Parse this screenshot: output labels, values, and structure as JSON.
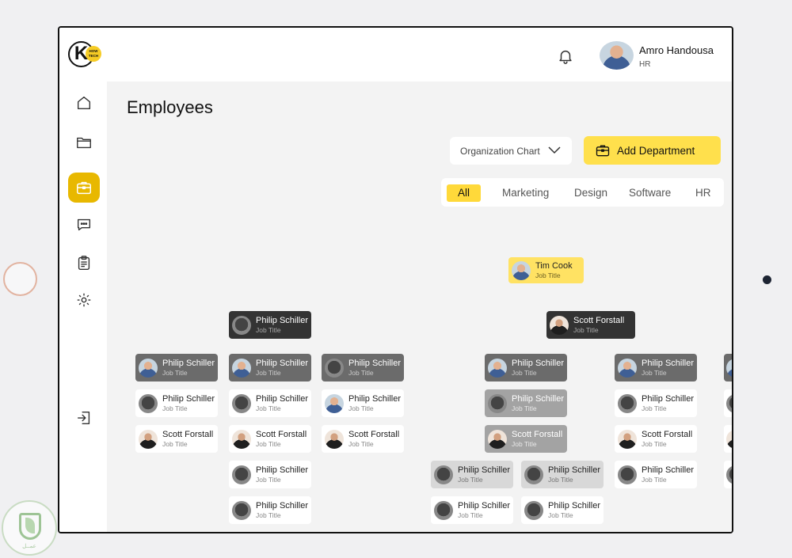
{
  "header": {
    "logo_letter": "K",
    "logo_tag": "HOW TECH",
    "user_name": "Amro Handousa",
    "user_role": "HR"
  },
  "sidebar": {
    "items": [
      {
        "icon": "home-icon"
      },
      {
        "icon": "folder-icon"
      },
      {
        "icon": "briefcase-icon",
        "active": true
      },
      {
        "icon": "chat-icon"
      },
      {
        "icon": "clipboard-icon"
      },
      {
        "icon": "gear-icon"
      }
    ],
    "logout_icon": "logout-icon"
  },
  "main": {
    "title": "Employees",
    "view_select": "Organization Chart",
    "add_button": "Add Department",
    "filters": [
      "All",
      "Marketing",
      "Design",
      "Software",
      "HR"
    ],
    "active_filter": "All"
  },
  "org": {
    "root": {
      "name": "Tim Cook",
      "job": "Job Title"
    },
    "leads": [
      {
        "name": "Philip Schiller",
        "job": "Job Title"
      },
      {
        "name": "Scott Forstall",
        "job": "Job Title"
      }
    ],
    "cards": [
      {
        "name": "Philip Schiller",
        "job": "Job Title"
      },
      {
        "name": "Philip Schiller",
        "job": "Job Title"
      },
      {
        "name": "Philip Schiller",
        "job": "Job Title"
      },
      {
        "name": "Philip Schiller",
        "job": "Job Title"
      },
      {
        "name": "Philip Schiller",
        "job": "Job Title"
      },
      {
        "name": "Philip Schiller",
        "job": "Job Title"
      },
      {
        "name": "Philip Schiller",
        "job": "Job Title"
      },
      {
        "name": "Philip Schiller",
        "job": "Job Title"
      },
      {
        "name": "Scott Forstall",
        "job": "Job Title"
      },
      {
        "name": "Scott Forstall",
        "job": "Job Title"
      },
      {
        "name": "Scott Forstall",
        "job": "Job Title"
      },
      {
        "name": "Philip Schiller",
        "job": "Job Title"
      },
      {
        "name": "Philip Schiller",
        "job": "Job Title"
      },
      {
        "name": "Philip Schiller",
        "job": "Job Title"
      },
      {
        "name": "Philip Schiller",
        "job": "Job Title"
      },
      {
        "name": "Philip Schiller",
        "job": "Job Title"
      },
      {
        "name": "Philip Schiller",
        "job": "Job Title"
      },
      {
        "name": "Scott Forstall",
        "job": "Job Title"
      },
      {
        "name": "Scott Forstall",
        "job": "Job Title"
      },
      {
        "name": "Philip Schiller",
        "job": "Job Title"
      },
      {
        "name": "Philip Schiller",
        "job": "Job Title"
      },
      {
        "name": "Philip Schiller",
        "job": "Job Title"
      },
      {
        "name": "Philip Schiller",
        "job": "Job Title"
      },
      {
        "name": "Philip Schiller",
        "job": "Job Title"
      }
    ]
  },
  "watermark": "عمــل"
}
